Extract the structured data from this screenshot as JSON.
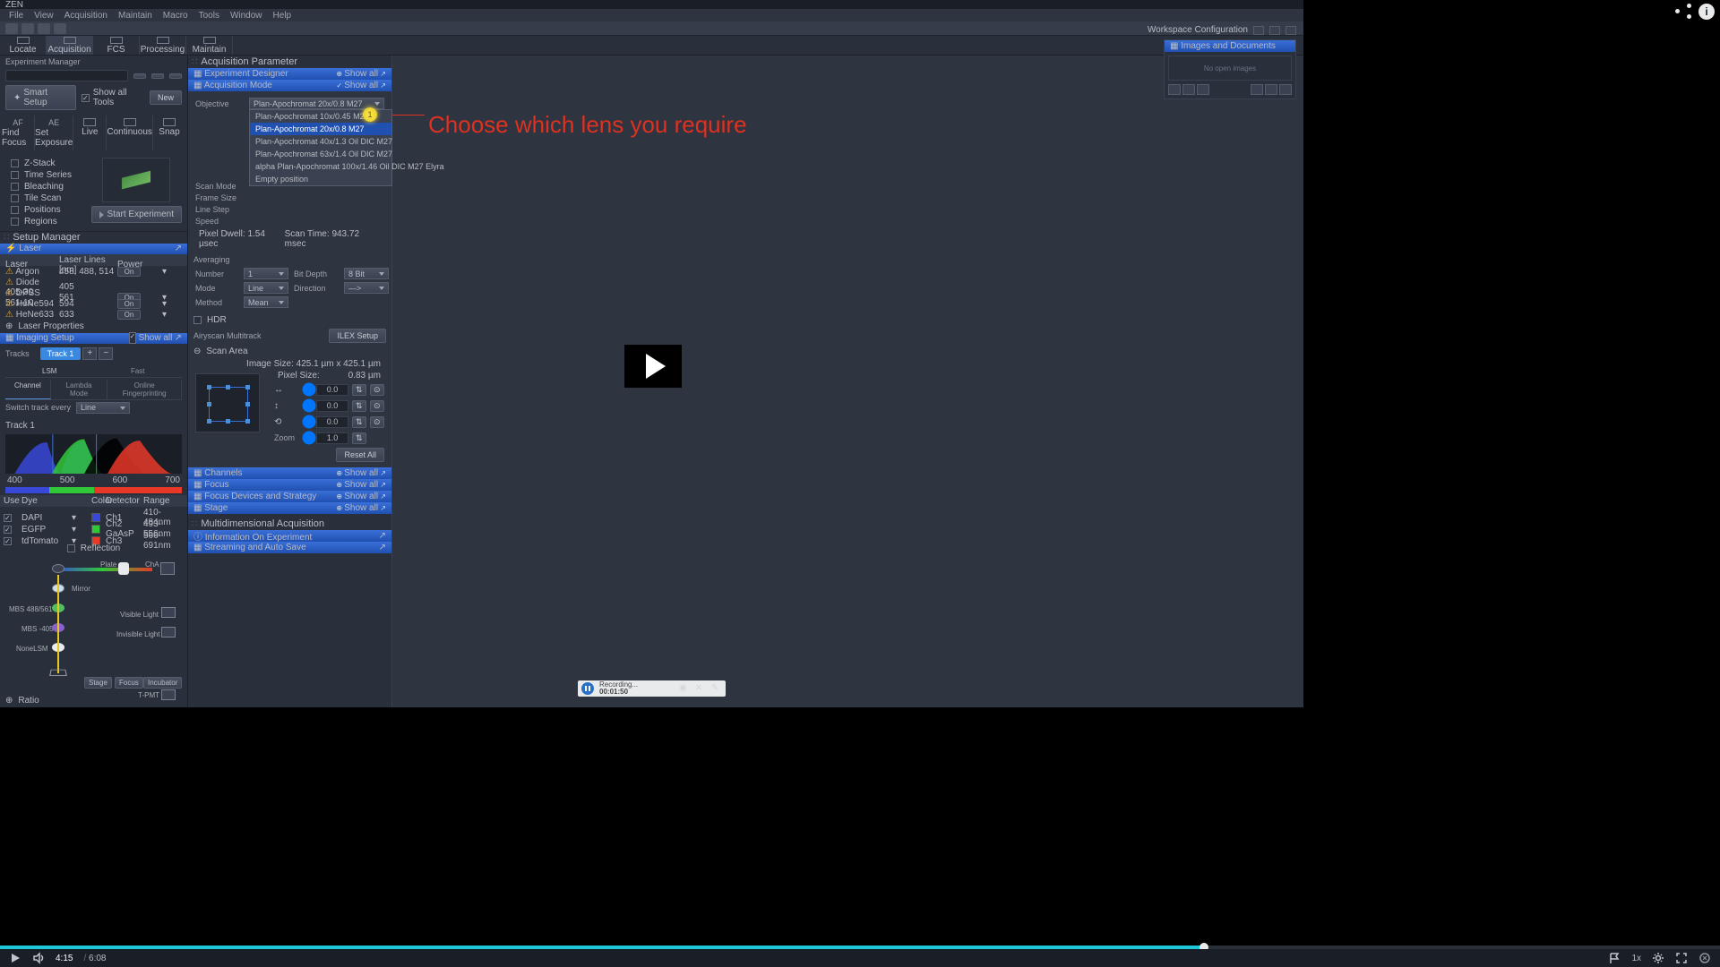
{
  "app_title": "ZEN",
  "menu": [
    "File",
    "View",
    "Acquisition",
    "Maintain",
    "Macro",
    "Tools",
    "Window",
    "Help"
  ],
  "modes": [
    {
      "label": "Locate"
    },
    {
      "label": "Acquisition",
      "active": true
    },
    {
      "label": "FCS"
    },
    {
      "label": "Processing"
    },
    {
      "label": "Maintain"
    }
  ],
  "workspace_cfg": "Workspace Configuration",
  "left": {
    "exp_mgr": "Experiment Manager",
    "smart_setup": "Smart Setup",
    "show_all_tools": "Show all Tools",
    "new": "New",
    "actions": [
      "Find Focus",
      "Set Exposure",
      "Live",
      "Continuous",
      "Snap"
    ],
    "actions_sub": [
      "AF",
      "AE",
      "",
      "",
      ""
    ],
    "dims": [
      "Z-Stack",
      "Time Series",
      "Bleaching",
      "Tile Scan",
      "Positions",
      "Regions"
    ],
    "start_exp": "Start Experiment",
    "setup_mgr": "Setup Manager",
    "laser_hdr": "Laser",
    "laser_cols": [
      "Laser",
      "Laser Lines [nm]",
      "Power",
      ""
    ],
    "lasers": [
      {
        "name": "Argon",
        "lines": "458, 488, 514",
        "pwr": "On",
        "warn": true
      },
      {
        "name": "Diode 405-30",
        "lines": "405",
        "pwr": ""
      },
      {
        "name": "DPSS 561-10",
        "lines": "561",
        "pwr": "On"
      },
      {
        "name": "HeNe594",
        "lines": "594",
        "pwr": "On"
      },
      {
        "name": "HeNe633",
        "lines": "633",
        "pwr": "On"
      }
    ],
    "laser_props": "Laser Properties",
    "imaging_setup": "Imaging Setup",
    "show_all": "Show all",
    "tracks_lbl": "Tracks",
    "track1": "Track 1",
    "subtabs": [
      "LSM",
      "Fast"
    ],
    "subtabs2": [
      "Channel",
      "Lambda Mode",
      "Online Fingerprinting"
    ],
    "switch_track": "Switch track every",
    "switch_val": "Line",
    "track_title": "Track 1",
    "axis": [
      "400",
      "500",
      "600",
      "700"
    ],
    "dye_cols": [
      "Use",
      "Dye",
      "",
      "Color",
      "Detector",
      "Range"
    ],
    "dyes": [
      {
        "name": "DAPI",
        "color": "#3848d8",
        "det": "Ch1",
        "range": "410-484nm"
      },
      {
        "name": "EGFP",
        "color": "#30c838",
        "det": "Ch2 GaAsP",
        "range": "493-556nm"
      },
      {
        "name": "tdTomato",
        "color": "#e83828",
        "det": "Ch3",
        "range": "566-691nm"
      }
    ],
    "reflection": "Reflection",
    "path": {
      "plate": "Plate",
      "cha": "ChA",
      "mirror": "Mirror",
      "mbs1": "MBS 488/561",
      "mbs2": "MBS -405",
      "none": "NoneLSM",
      "vis": "Visible Light",
      "inv": "Invisible Light",
      "tpmt": "T-PMT",
      "stage": "Stage",
      "focus": "Focus",
      "incub": "Incubator"
    },
    "ratio": "Ratio"
  },
  "mid": {
    "title": "Acquisition Parameter",
    "bars": [
      {
        "label": "Experiment Designer",
        "r": "Show all"
      },
      {
        "label": "Acquisition Mode",
        "r": "Show all"
      }
    ],
    "objective": "Objective",
    "obj_sel": "Plan-Apochromat 20x/0.8 M27",
    "obj_opts": [
      "Plan-Apochromat 10x/0.45 M27",
      "Plan-Apochromat 20x/0.8 M27",
      "Plan-Apochromat 40x/1.3 Oil DIC M27",
      "Plan-Apochromat 63x/1.4 Oil DIC M27",
      "alpha Plan-Apochromat 100x/1.46 Oil DIC M27 Elyra",
      "Empty position"
    ],
    "scan_mode": "Scan Mode",
    "frame_size": "Frame Size",
    "line_step": "Line Step",
    "speed": "Speed",
    "pixel_dwell": "Pixel Dwell:",
    "pd_val": "1.54 µsec",
    "scan_time": "Scan Time:",
    "st_val": "943.72 msec",
    "averaging": "Averaging",
    "avg": {
      "number": "Number",
      "mode": "Mode",
      "method": "Method",
      "bitdepth": "Bit Depth",
      "direction": "Direction",
      "number_v": "1",
      "mode_v": "Line",
      "method_v": "Mean",
      "bit_v": "8 Bit",
      "dir_v": "—>"
    },
    "hdr": "HDR",
    "airyscan": "Airyscan Multitrack",
    "ilex": "ILEX Setup",
    "scan_area": "Scan Area",
    "img_size": "Image Size:",
    "img_size_v": "425.1 µm x 425.1 µm",
    "px_size": "Pixel Size:",
    "px_size_v": "0.83 µm",
    "offsets": [
      {
        "v": "0.0"
      },
      {
        "v": "0.0"
      },
      {
        "v": "0.0"
      }
    ],
    "zoom": "Zoom",
    "zoom_v": "1.0",
    "reset": "Reset All",
    "lower_bars": [
      {
        "label": "Channels",
        "r": "Show all"
      },
      {
        "label": "Focus",
        "r": "Show all"
      },
      {
        "label": "Focus Devices and Strategy",
        "r": "Show all"
      },
      {
        "label": "Stage",
        "r": "Show all"
      }
    ],
    "multi_title": "Multidimensional Acquisition",
    "multi_bars": [
      {
        "label": "Information On Experiment"
      },
      {
        "label": "Streaming and Auto Save"
      }
    ]
  },
  "right": {
    "title": "Images and Documents",
    "empty": "No open images"
  },
  "annotation": "Choose which lens you require",
  "recorder": {
    "label": "Recording...",
    "time": "00:01:50"
  },
  "video": {
    "cur": "4:15",
    "dur": "6:08",
    "speed": "1x"
  },
  "highlight_badge": "1"
}
